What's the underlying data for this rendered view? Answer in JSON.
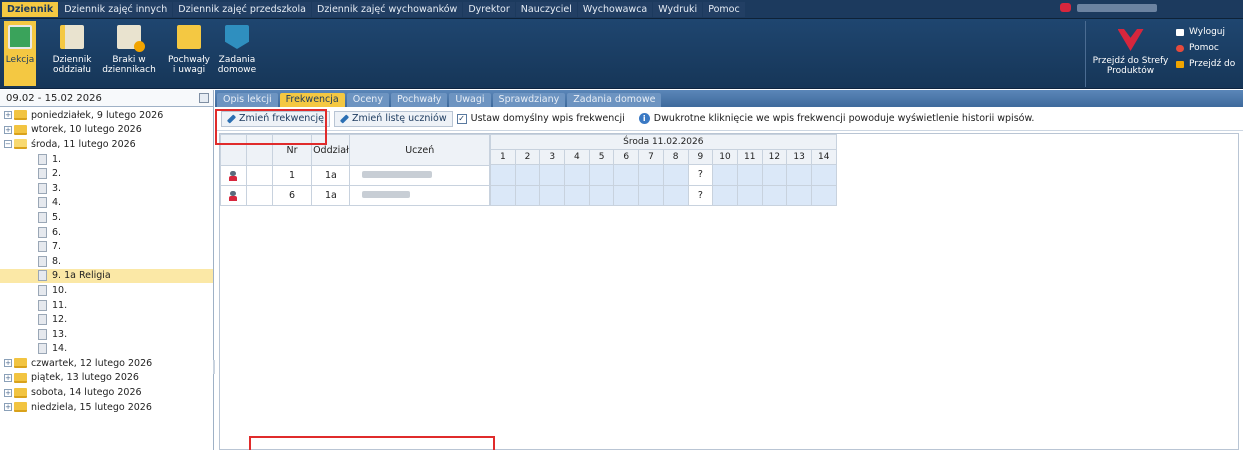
{
  "topbar": {
    "menu": [
      "Dziennik",
      "Dziennik zajęć innych",
      "Dziennik zajęć przedszkola",
      "Dziennik zajęć wychowanków",
      "Dyrektor",
      "Nauczyciel",
      "Wychowawca",
      "Wydruki",
      "Pomoc"
    ],
    "active_menu": "Dziennik"
  },
  "ribbon": {
    "buttons": [
      {
        "label": "Lekcja",
        "icon": "lesson-icon"
      },
      {
        "label": "Dziennik oddziału",
        "icon": "class-journal-icon"
      },
      {
        "label": "Braki w dziennikach",
        "icon": "journal-gaps-icon"
      },
      {
        "label": "Pochwały i uwagi",
        "icon": "praise-remarks-icon"
      },
      {
        "label": "Zadania domowe",
        "icon": "homework-icon"
      }
    ],
    "strefy_label": "Przejdź do Strefy Produktów",
    "side": {
      "logout": "Wyloguj",
      "help": "Pomoc",
      "goto": "Przejdź do"
    }
  },
  "left": {
    "date_range": "09.02 - 15.02 2026",
    "days_before": [
      "poniedziałek, 9 lutego 2026",
      "wtorek, 10 lutego 2026"
    ],
    "open_day": "środa, 11 lutego 2026",
    "lessons": [
      "1.",
      "2.",
      "3.",
      "4.",
      "5.",
      "6.",
      "7.",
      "8.",
      "9. 1a Religia",
      "10.",
      "11.",
      "12.",
      "13.",
      "14."
    ],
    "selected_lesson": "9. 1a Religia",
    "days_after": [
      "czwartek, 12 lutego 2026",
      "piątek, 13 lutego 2026",
      "sobota, 14 lutego 2026",
      "niedziela, 15 lutego 2026"
    ]
  },
  "tabs": [
    "Opis lekcji",
    "Frekwencja",
    "Oceny",
    "Pochwały",
    "Uwagi",
    "Sprawdziany",
    "Zadania domowe"
  ],
  "active_tab": "Frekwencja",
  "toolbar": {
    "change_attendance": "Zmień frekwencję",
    "change_students": "Zmień listę uczniów",
    "default_entry": "Ustaw domyślny wpis frekwencji",
    "info_text": "Dwukrotne kliknięcie we wpis frekwencji powoduje wyświetlenie historii wpisów."
  },
  "table": {
    "headers": {
      "nr": "Nr",
      "class": "Oddział",
      "student": "Uczeń"
    },
    "day_header": "Środa 11.02.2026",
    "periods": [
      "1",
      "2",
      "3",
      "4",
      "5",
      "6",
      "7",
      "8",
      "9",
      "10",
      "11",
      "12",
      "13",
      "14"
    ],
    "rows": [
      {
        "nr": "1",
        "class": "1a",
        "marks": [
          "",
          "",
          "",
          "",
          "",
          "",
          "",
          "",
          "?",
          "",
          "",
          "",
          "",
          ""
        ]
      },
      {
        "nr": "6",
        "class": "1a",
        "marks": [
          "",
          "",
          "",
          "",
          "",
          "",
          "",
          "",
          "?",
          "",
          "",
          "",
          "",
          ""
        ]
      }
    ]
  }
}
